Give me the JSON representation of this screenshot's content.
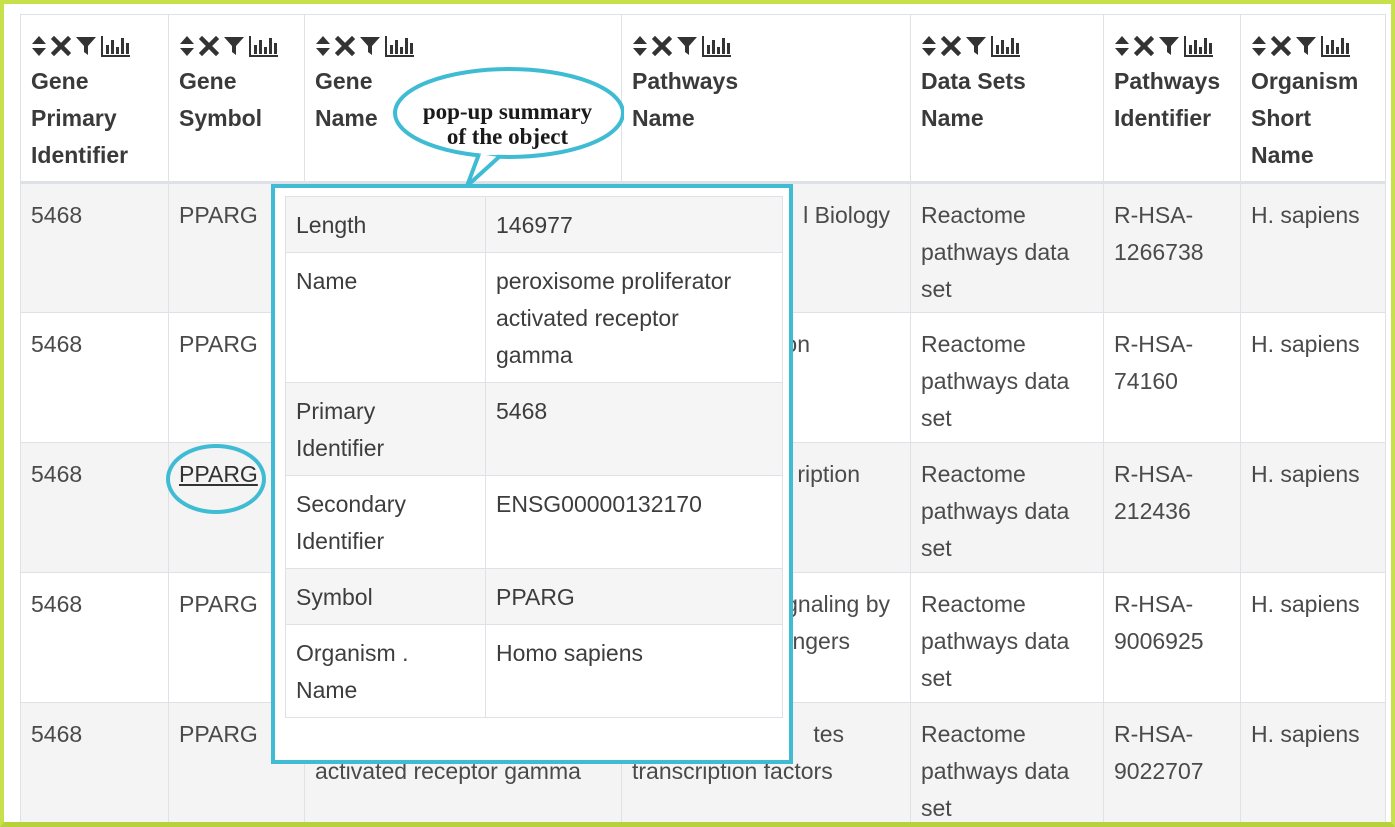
{
  "columns": [
    {
      "line1": "Gene",
      "line2": "Primary",
      "line3": "Identifier"
    },
    {
      "line1": "Gene",
      "line2": "Symbol",
      "line3": ""
    },
    {
      "line1": "Gene",
      "line2": "Name",
      "line3": ""
    },
    {
      "line1": "Pathways",
      "line2": "Name",
      "line3": ""
    },
    {
      "line1": "Data Sets",
      "line2": "Name",
      "line3": ""
    },
    {
      "line1": "Pathways",
      "line2": "Identifier",
      "line3": ""
    },
    {
      "line1": "Organism",
      "line2": "Short",
      "line3": "Name"
    }
  ],
  "rows": [
    {
      "primary_id": "5468",
      "symbol": "PPARG",
      "gene_name": [
        "",
        ""
      ],
      "pathway": [
        "l Biology",
        ""
      ],
      "dataset": [
        "Reactome",
        "pathways data",
        "set"
      ],
      "pathway_id": [
        "R-HSA-",
        "1266738"
      ],
      "organism": "H. sapiens"
    },
    {
      "primary_id": "5468",
      "symbol": "PPARG",
      "gene_name": [
        "",
        ""
      ],
      "pathway": [
        "on",
        ""
      ],
      "dataset": [
        "Reactome",
        "pathways data",
        "set"
      ],
      "pathway_id": [
        "R-HSA-",
        "74160"
      ],
      "organism": "H. sapiens"
    },
    {
      "primary_id": "5468",
      "symbol": "PPARG",
      "gene_name": [
        "",
        ""
      ],
      "pathway": [
        "ription",
        ""
      ],
      "dataset": [
        "Reactome",
        "pathways data",
        "set"
      ],
      "pathway_id": [
        "R-HSA-",
        "212436"
      ],
      "organism": "H. sapiens"
    },
    {
      "primary_id": "5468",
      "symbol": "PPARG",
      "gene_name": [
        "",
        ""
      ],
      "pathway": [
        "gnaling by",
        "ngers"
      ],
      "dataset": [
        "Reactome",
        "pathways data",
        "set"
      ],
      "pathway_id": [
        "R-HSA-",
        "9006925"
      ],
      "organism": "H. sapiens"
    },
    {
      "primary_id": "5468",
      "symbol": "PPARG",
      "gene_name": [
        "",
        "activated receptor gamma"
      ],
      "pathway": [
        "tes",
        "transcription factors"
      ],
      "dataset": [
        "Reactome",
        "pathways data",
        "set"
      ],
      "pathway_id": [
        "R-HSA-",
        "9022707"
      ],
      "organism": "H. sapiens"
    }
  ],
  "popup": {
    "rows": [
      {
        "key": [
          "Length"
        ],
        "value": [
          "146977"
        ]
      },
      {
        "key": [
          "Name"
        ],
        "value": [
          "peroxisome proliferator",
          "activated receptor",
          "gamma"
        ]
      },
      {
        "key": [
          "Primary",
          "Identifier"
        ],
        "value": [
          "5468"
        ]
      },
      {
        "key": [
          "Secondary",
          "Identifier"
        ],
        "value": [
          "ENSG00000132170"
        ]
      },
      {
        "key": [
          "Symbol"
        ],
        "value": [
          "PPARG"
        ]
      },
      {
        "key": [
          "Organism .",
          "Name"
        ],
        "value": [
          "Homo sapiens"
        ]
      }
    ]
  },
  "callout": {
    "line1": "pop-up summary",
    "line2": "of the object"
  },
  "tool_icons": [
    "sort-icon",
    "close-icon",
    "filter-icon",
    "bar-chart-icon"
  ],
  "colors": {
    "frame": "#c6e14a",
    "highlight": "#3fbcd3"
  }
}
